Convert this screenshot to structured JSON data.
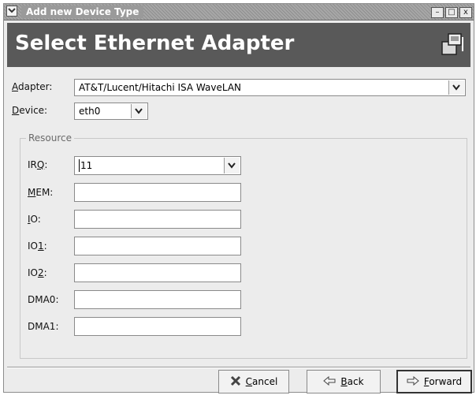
{
  "window": {
    "title": "Add new Device Type",
    "controls": {
      "minimize": "–",
      "maximize": "□",
      "close": "x"
    }
  },
  "header": {
    "title": "Select Ethernet Adapter"
  },
  "adapter": {
    "label_mnemonic": "A",
    "label_rest": "dapter:",
    "value": "AT&T/Lucent/Hitachi ISA WaveLAN"
  },
  "device": {
    "label_mnemonic": "D",
    "label_rest": "evice:",
    "value": "eth0"
  },
  "resource": {
    "group_label": "Resource",
    "irq": {
      "label_pre": "IR",
      "label_mnemonic": "Q",
      "label_post": ":",
      "value": "11"
    },
    "mem": {
      "label_mnemonic": "M",
      "label_rest": "EM:",
      "value": ""
    },
    "io": {
      "label_mnemonic": "I",
      "label_rest": "O:",
      "value": ""
    },
    "io1": {
      "label_pre": "IO",
      "label_mnemonic": "1",
      "label_post": ":",
      "value": ""
    },
    "io2": {
      "label_pre": "IO",
      "label_mnemonic": "2",
      "label_post": ":",
      "value": ""
    },
    "dma0": {
      "label": "DMA0:",
      "value": ""
    },
    "dma1": {
      "label": "DMA1:",
      "value": ""
    }
  },
  "buttons": {
    "cancel": {
      "mnemonic": "C",
      "rest": "ancel"
    },
    "back": {
      "mnemonic": "B",
      "rest": "ack"
    },
    "forward": {
      "mnemonic": "F",
      "rest": "orward"
    }
  }
}
